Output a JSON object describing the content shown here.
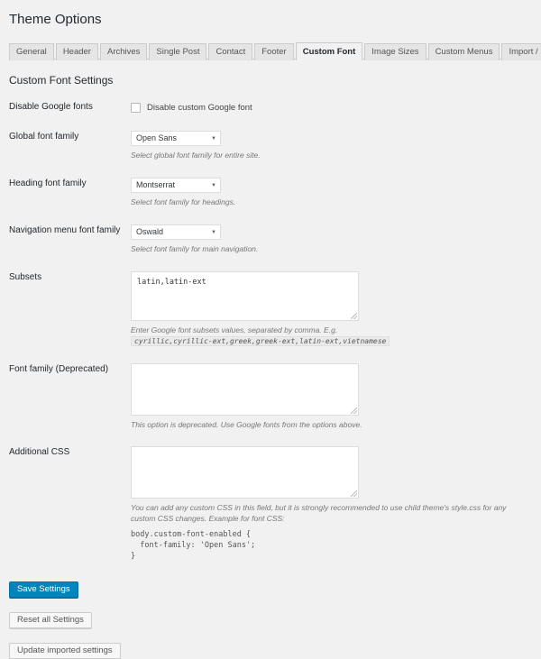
{
  "page": {
    "title": "Theme Options",
    "section_heading": "Custom Font Settings"
  },
  "tabs": [
    {
      "label": "General",
      "active": false
    },
    {
      "label": "Header",
      "active": false
    },
    {
      "label": "Archives",
      "active": false
    },
    {
      "label": "Single Post",
      "active": false
    },
    {
      "label": "Contact",
      "active": false
    },
    {
      "label": "Footer",
      "active": false
    },
    {
      "label": "Custom Font",
      "active": true
    },
    {
      "label": "Image Sizes",
      "active": false
    },
    {
      "label": "Custom Menus",
      "active": false
    },
    {
      "label": "Import / Export",
      "active": false
    }
  ],
  "fields": {
    "disable_google_fonts": {
      "label": "Disable Google fonts",
      "checkbox_label": "Disable custom Google font",
      "checked": false
    },
    "global_font_family": {
      "label": "Global font family",
      "value": "Open Sans",
      "description": "Select global font family for entire site."
    },
    "heading_font_family": {
      "label": "Heading font family",
      "value": "Montserrat",
      "description": "Select font family for headings."
    },
    "navigation_font_family": {
      "label": "Navigation menu font family",
      "value": "Oswald",
      "description": "Select font family for main navigation."
    },
    "subsets": {
      "label": "Subsets",
      "value": "latin,latin-ext",
      "description_before": "Enter Google font subsets values, separated by comma. E.g.",
      "description_code": "cyrillic,cyrillic-ext,greek,greek-ext,latin-ext,vietnamese"
    },
    "font_family_deprecated": {
      "label": "Font family (Deprecated)",
      "value": "",
      "description": "This option is deprecated. Use Google fonts from the options above."
    },
    "additional_css": {
      "label": "Additional CSS",
      "value": "",
      "description": "You can add any custom CSS in this field, but it is strongly recommended to use child theme's style.css for any custom CSS changes. Example for font CSS:",
      "code_example": "body.custom-font-enabled {\n  font-family: 'Open Sans';\n}"
    }
  },
  "buttons": {
    "save": "Save Settings",
    "reset": "Reset all Settings",
    "update_imported": "Update imported settings"
  },
  "colors": {
    "primary": "#0085ba",
    "page_background": "#f1f1f1",
    "text": "#23282d"
  }
}
